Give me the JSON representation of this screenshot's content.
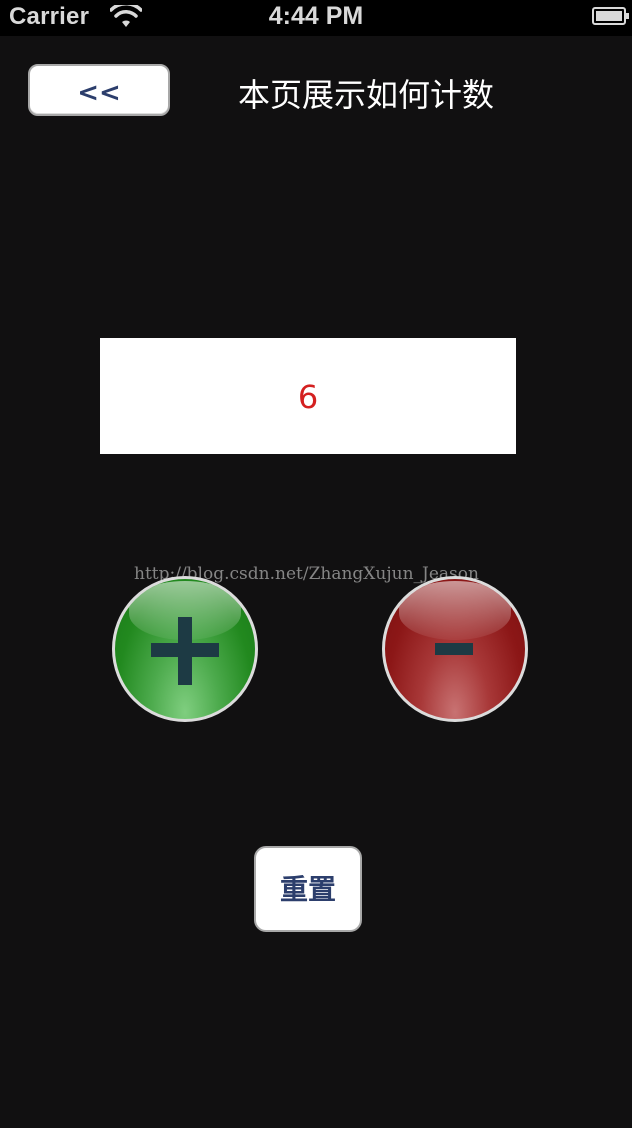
{
  "status_bar": {
    "carrier": "Carrier",
    "time": "4:44 PM",
    "wifi_icon": "wifi-icon",
    "battery_icon": "battery-icon"
  },
  "nav": {
    "back_label": "<<",
    "title": "本页展示如何计数"
  },
  "counter": {
    "value": "6",
    "color": "#d42020"
  },
  "watermark": "http://blog.csdn.net/ZhangXujun_Jeason",
  "controls": {
    "plus_icon": "plus-icon",
    "minus_icon": "minus-icon",
    "plus_color": "#22891f",
    "minus_color": "#8c1717",
    "reset_label": "重置"
  }
}
